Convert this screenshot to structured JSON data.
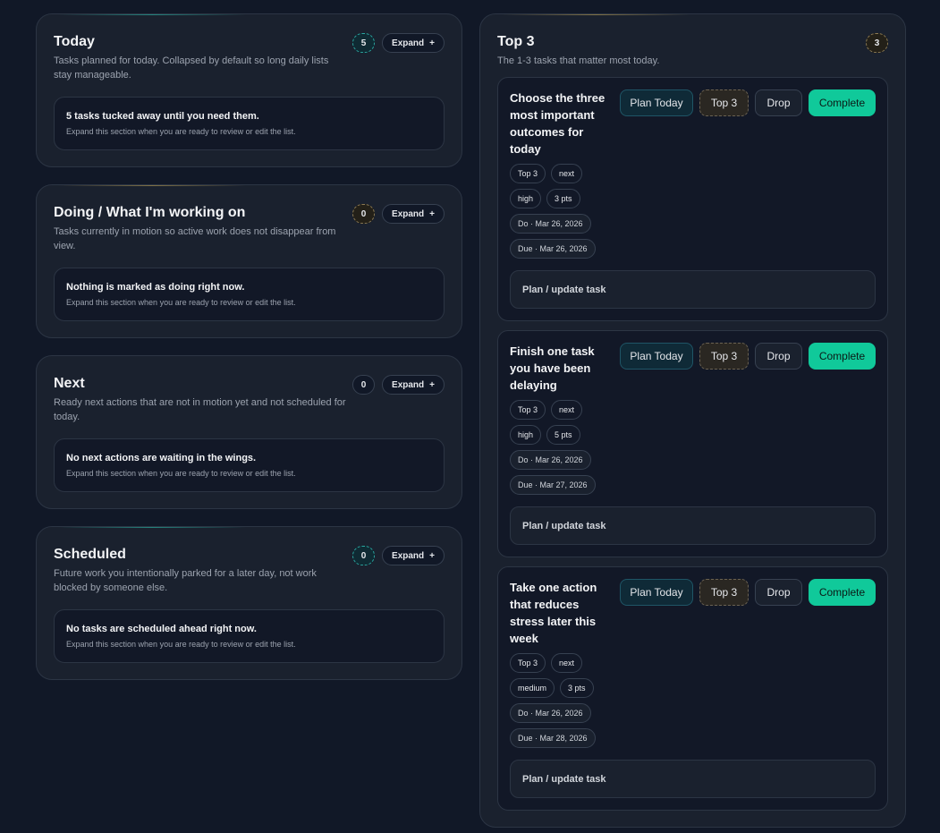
{
  "sections": [
    {
      "title": "Today",
      "description": "Tasks planned for today. Collapsed by default so long daily lists stay manageable.",
      "count": "5",
      "expand_label": "Expand",
      "expand_icon": "+",
      "collapsed_title": "5 tasks tucked away until you need them.",
      "collapsed_sub": "Expand this section when you are ready to review or edit the list."
    },
    {
      "title": "Doing / What I'm working on",
      "description": "Tasks currently in motion so active work does not disappear from view.",
      "count": "0",
      "expand_label": "Expand",
      "expand_icon": "+",
      "collapsed_title": "Nothing is marked as doing right now.",
      "collapsed_sub": "Expand this section when you are ready to review or edit the list."
    },
    {
      "title": "Next",
      "description": "Ready next actions that are not in motion yet and not scheduled for today.",
      "count": "0",
      "expand_label": "Expand",
      "expand_icon": "+",
      "collapsed_title": "No next actions are waiting in the wings.",
      "collapsed_sub": "Expand this section when you are ready to review or edit the list."
    },
    {
      "title": "Scheduled",
      "description": "Future work you intentionally parked for a later day, not work blocked by someone else.",
      "count": "0",
      "expand_label": "Expand",
      "expand_icon": "+",
      "collapsed_title": "No tasks are scheduled ahead right now.",
      "collapsed_sub": "Expand this section when you are ready to review or edit the list."
    }
  ],
  "top3": {
    "title": "Top 3",
    "description": "The 1-3 tasks that matter most today.",
    "count": "3",
    "actions": {
      "plan_today": "Plan Today",
      "top3": "Top 3",
      "drop": "Drop",
      "complete": "Complete",
      "update": "Plan / update task"
    },
    "tasks": [
      {
        "title": "Choose the three most important outcomes for today",
        "tags": [
          "Top 3",
          "next",
          "high",
          "3 pts"
        ],
        "do_date": "Do · Mar 26, 2026",
        "due_date": "Due · Mar 26, 2026"
      },
      {
        "title": "Finish one task you have been delaying",
        "tags": [
          "Top 3",
          "next",
          "high",
          "5 pts"
        ],
        "do_date": "Do · Mar 26, 2026",
        "due_date": "Due · Mar 27, 2026"
      },
      {
        "title": "Take one action that reduces stress later this week",
        "tags": [
          "Top 3",
          "next",
          "medium",
          "3 pts"
        ],
        "do_date": "Do · Mar 26, 2026",
        "due_date": "Due · Mar 28, 2026"
      }
    ]
  },
  "colors": {
    "background": "#111827",
    "panel": "#1a212e",
    "accent_teal": "#2dd4bf",
    "complete_green": "#10c99a",
    "top3_amber": "#8c7a52"
  },
  "icons": {
    "expand": "plus-icon"
  }
}
